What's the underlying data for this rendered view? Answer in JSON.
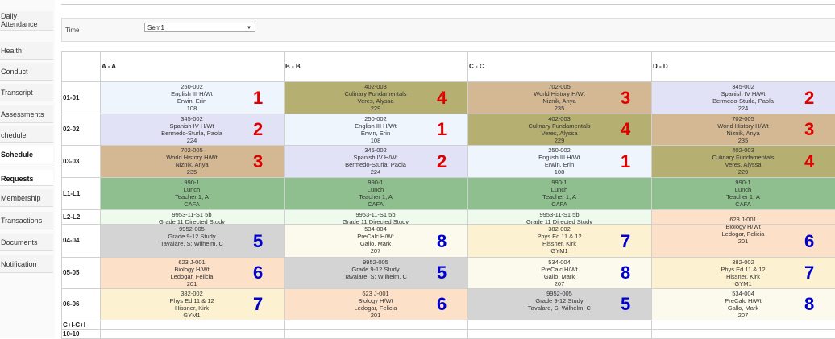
{
  "sidebar": {
    "items": [
      {
        "label": "Daily Attendance",
        "bold": false
      },
      {
        "label": "Health",
        "bold": false
      },
      {
        "label": "Conduct",
        "bold": false
      },
      {
        "label": "Transcript",
        "bold": false
      },
      {
        "label": "Assessments",
        "bold": false
      },
      {
        "label": "chedule",
        "bold": false
      },
      {
        "label": "Schedule",
        "bold": true
      },
      {
        "label": "Requests",
        "bold": true
      },
      {
        "label": "Membership",
        "bold": false
      },
      {
        "label": "Transactions",
        "bold": false
      },
      {
        "label": "Documents",
        "bold": false
      },
      {
        "label": "Notification",
        "bold": false
      }
    ]
  },
  "time": {
    "label": "Time",
    "selected": "Sem1"
  },
  "columns": [
    "A - A",
    "B - B",
    "C - C",
    "D - D"
  ],
  "rows": [
    "01-01",
    "02-02",
    "03-03",
    "L1-L1",
    "L2-L2",
    "04-04",
    "05-05",
    "06-06",
    "C+I-C+I",
    "10-10"
  ],
  "colors": {
    "english": "#eef5fd",
    "culinary": "#b5b072",
    "history": "#d4b894",
    "spanish": "#e2e2f6",
    "lunch": "#8fbf8f",
    "study11": "#eefaec",
    "biology": "#fde0c8",
    "study": "#d4d4d4",
    "precalc": "#fcfaec",
    "pe": "#fcf2d2",
    "red": "#e00000",
    "blue": "#0000cc"
  },
  "cells": [
    {
      "key": "english",
      "lines": [
        "250-002",
        "English III H/Wt",
        "Erwin, Erin",
        "108"
      ],
      "num": "1",
      "numColor": "red"
    },
    {
      "key": "culinary",
      "lines": [
        "402-003",
        "Culinary Fundamentals",
        "Veres, Alyssa",
        "229"
      ],
      "num": "4",
      "numColor": "red"
    },
    {
      "key": "history",
      "lines": [
        "702-005",
        "World History H/Wt",
        "Niznik, Anya",
        "235"
      ],
      "num": "3",
      "numColor": "red"
    },
    {
      "key": "spanish",
      "lines": [
        "345-002",
        "Spanish IV H/Wt",
        "Bermedo-Sturla, Paola",
        "224"
      ],
      "num": "2",
      "numColor": "red"
    },
    {
      "key": "spanish",
      "lines": [
        "345-002",
        "Spanish IV H/Wt",
        "Bermedo-Sturla, Paola",
        "224"
      ],
      "num": "2",
      "numColor": "red"
    },
    {
      "key": "english",
      "lines": [
        "250-002",
        "English III H/Wt",
        "Erwin, Erin",
        "108"
      ],
      "num": "1",
      "numColor": "red"
    },
    {
      "key": "culinary",
      "lines": [
        "402-003",
        "Culinary Fundamentals",
        "Veres, Alyssa",
        "229"
      ],
      "num": "4",
      "numColor": "red"
    },
    {
      "key": "history",
      "lines": [
        "702-005",
        "World History H/Wt",
        "Niznik, Anya",
        "235"
      ],
      "num": "3",
      "numColor": "red"
    },
    {
      "key": "history",
      "lines": [
        "702-005",
        "World History H/Wt",
        "Niznik, Anya",
        "235"
      ],
      "num": "3",
      "numColor": "red"
    },
    {
      "key": "spanish",
      "lines": [
        "345-002",
        "Spanish IV H/Wt",
        "Bermedo-Sturla, Paola",
        "224"
      ],
      "num": "2",
      "numColor": "red"
    },
    {
      "key": "english",
      "lines": [
        "250-002",
        "English III H/Wt",
        "Erwin, Erin",
        "108"
      ],
      "num": "1",
      "numColor": "red"
    },
    {
      "key": "culinary",
      "lines": [
        "402-003",
        "Culinary Fundamentals",
        "Veres, Alyssa",
        "229"
      ],
      "num": "4",
      "numColor": "red"
    },
    {
      "key": "lunch",
      "lines": [
        "990-1",
        "Lunch",
        "Teacher 1, A",
        "CAFA"
      ],
      "num": "",
      "numColor": "red"
    },
    {
      "key": "lunch",
      "lines": [
        "990-1",
        "Lunch",
        "Teacher 1, A",
        "CAFA"
      ],
      "num": "",
      "numColor": "red"
    },
    {
      "key": "lunch",
      "lines": [
        "990-1",
        "Lunch",
        "Teacher 1, A",
        "CAFA"
      ],
      "num": "",
      "numColor": "red"
    },
    {
      "key": "lunch",
      "lines": [
        "990-1",
        "Lunch",
        "Teacher 1, A",
        "CAFA"
      ],
      "num": "",
      "numColor": "red"
    },
    {
      "key": "study11",
      "lines": [
        "9953-11-S1 5b",
        "Grade 11 Directed Study"
      ],
      "num": "",
      "numColor": "red"
    },
    {
      "key": "study11",
      "lines": [
        "9953-11-S1 5b",
        "Grade 11 Directed Study"
      ],
      "num": "",
      "numColor": "red"
    },
    {
      "key": "study11",
      "lines": [
        "9953-11-S1 5b",
        "Grade 11 Directed Study"
      ],
      "num": "",
      "numColor": "red"
    },
    {
      "key": "study",
      "lines": [
        "9952-005",
        "Grade 9-12 Study",
        "Tavalare, S; Wilhelm, C"
      ],
      "num": "5",
      "numColor": "blue"
    },
    {
      "key": "precalc",
      "lines": [
        "534-004",
        "PreCalc H/Wt",
        "Gallo, Mark",
        "207"
      ],
      "num": "8",
      "numColor": "blue"
    },
    {
      "key": "pe",
      "lines": [
        "382-002",
        "Phys Ed 11 & 12",
        "Hissner, Kirk",
        "GYM1"
      ],
      "num": "7",
      "numColor": "blue"
    },
    {
      "key": "biology",
      "lines": [
        "623 J-001",
        "Biology H/Wt",
        "Ledogar, Felicia",
        "201"
      ],
      "num": "6",
      "numColor": "blue"
    },
    {
      "key": "biology",
      "lines": [
        "623 J-001",
        "Biology H/Wt",
        "Ledogar, Felicia",
        "201"
      ],
      "num": "6",
      "numColor": "blue"
    },
    {
      "key": "study",
      "lines": [
        "9952-005",
        "Grade 9-12 Study",
        "Tavalare, S; Wilhelm, C"
      ],
      "num": "5",
      "numColor": "blue"
    },
    {
      "key": "precalc",
      "lines": [
        "534-004",
        "PreCalc H/Wt",
        "Gallo, Mark",
        "207"
      ],
      "num": "8",
      "numColor": "blue"
    },
    {
      "key": "pe",
      "lines": [
        "382-002",
        "Phys Ed 11 & 12",
        "Hissner, Kirk",
        "GYM1"
      ],
      "num": "7",
      "numColor": "blue"
    },
    {
      "key": "pe",
      "lines": [
        "382-002",
        "Phys Ed 11 & 12",
        "Hissner, Kirk",
        "GYM1"
      ],
      "num": "7",
      "numColor": "blue"
    },
    {
      "key": "biology",
      "lines": [
        "623 J-001",
        "Biology H/Wt",
        "Ledogar, Felicia",
        "201"
      ],
      "num": "6",
      "numColor": "blue"
    },
    {
      "key": "study",
      "lines": [
        "9952-005",
        "Grade 9-12 Study",
        "Tavalare, S; Wilhelm, C"
      ],
      "num": "5",
      "numColor": "blue"
    },
    {
      "key": "precalc",
      "lines": [
        "534-004",
        "PreCalc H/Wt",
        "Gallo, Mark",
        "207"
      ],
      "num": "8",
      "numColor": "blue"
    }
  ]
}
